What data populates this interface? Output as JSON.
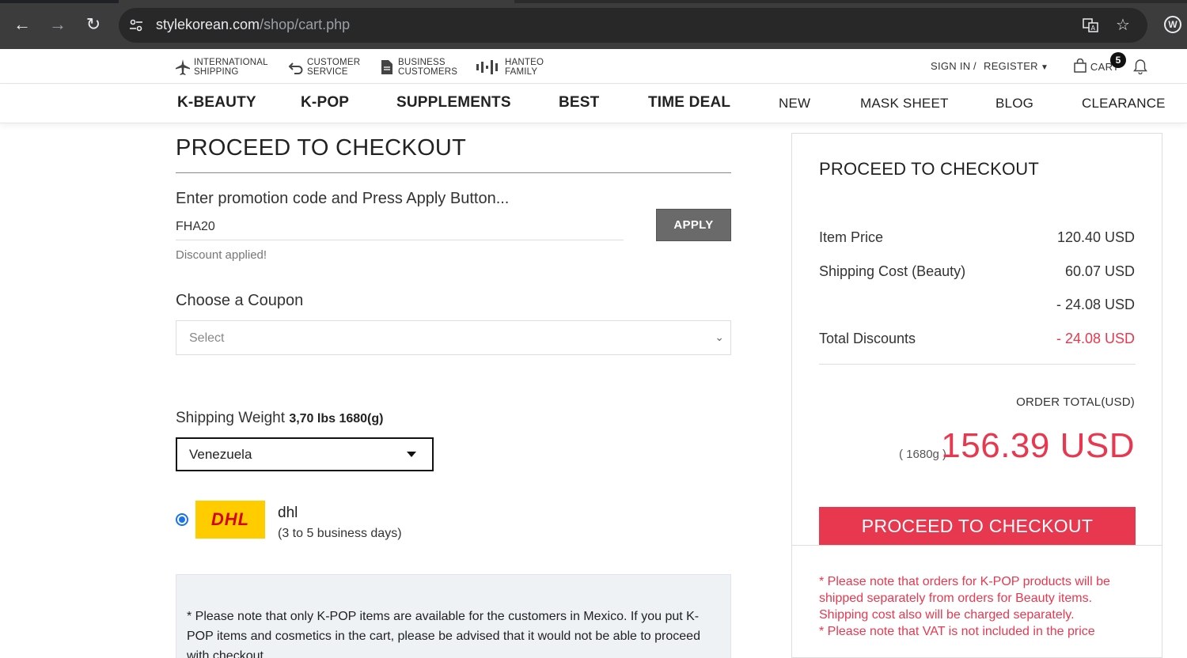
{
  "browser": {
    "url_host": "stylekorean.com",
    "url_path": "/shop/cart.php"
  },
  "util_bar": {
    "items": [
      {
        "label": "INTERNATIONAL\nSHIPPING",
        "icon": "airplane-icon"
      },
      {
        "label": "CUSTOMER\nSERVICE",
        "icon": "return-arrow-icon"
      },
      {
        "label": "BUSINESS\nCUSTOMERS",
        "icon": "document-icon"
      },
      {
        "label": "HANTEO\nFAMILY",
        "icon": "sound-bars-icon"
      }
    ],
    "sign_in": "SIGN IN",
    "separator": "/",
    "register": "REGISTER",
    "cart_label": "CART",
    "cart_count": "5"
  },
  "main_nav": {
    "items": [
      "K-BEAUTY",
      "K-POP",
      "SUPPLEMENTS",
      "BEST",
      "TIME DEAL",
      "NEW",
      "MASK SHEET",
      "BLOG",
      "CLEARANCE"
    ]
  },
  "checkout": {
    "title": "PROCEED TO CHECKOUT",
    "promo_heading": "Enter promotion code and Press Apply Button...",
    "promo_code": "FHA20",
    "apply_label": "APPLY",
    "discount_message": "Discount applied!",
    "coupon_heading": "Choose a Coupon",
    "coupon_selected": "Select",
    "shipping_weight_label": "Shipping Weight",
    "shipping_weight_value": "3,70 lbs 1680(g)",
    "country_selected": "Venezuela",
    "carrier_name": "dhl",
    "carrier_logo_text": "DHL",
    "carrier_days": "(3 to 5 business days)",
    "notice": "* Please note that only K-POP items are available for the customers in Mexico. If you put K-POP items and cosmetics in the cart, please be advised that it would not be able to proceed with checkout."
  },
  "summary": {
    "title": "PROCEED TO CHECKOUT",
    "item_price_label": "Item Price",
    "item_price_value": "120.40 USD",
    "shipping_label": "Shipping Cost (Beauty)",
    "shipping_value": "60.07 USD",
    "extra_discount_value": "- 24.08 USD",
    "total_discounts_label": "Total Discounts",
    "total_discounts_value": "- 24.08 USD",
    "order_total_label": "ORDER TOTAL(USD)",
    "total_weight": "( 1680g )",
    "total_amount": "156.39 USD",
    "checkout_button": "PROCEED TO CHECKOUT",
    "note_1": "* Please note that orders for K-POP products will be shipped separately from orders for Beauty items. Shipping cost also will be charged separately.",
    "note_2": "* Please note that VAT is not included in the price"
  },
  "colors": {
    "accent_red": "#e8384f",
    "dhl_yellow": "#ffcc00",
    "dhl_red": "#d40511"
  }
}
